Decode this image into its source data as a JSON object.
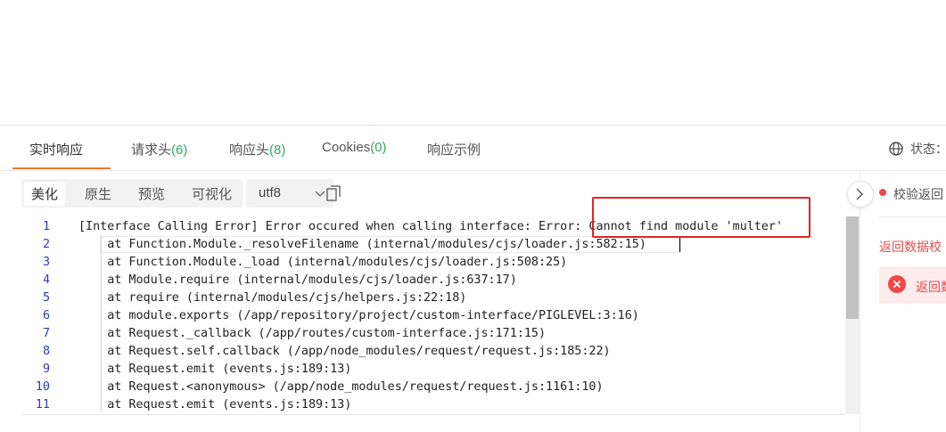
{
  "tabs": [
    {
      "label": "实时响应",
      "count": ""
    },
    {
      "label": "请求头",
      "count": "(6)"
    },
    {
      "label": "响应头",
      "count": "(8)"
    },
    {
      "label": "Cookies",
      "count": "(0)"
    },
    {
      "label": "响应示例",
      "count": ""
    }
  ],
  "status_label": "状态：",
  "toolbar": {
    "modes": [
      "美化",
      "原生",
      "预览",
      "可视化"
    ],
    "active_mode": "美化",
    "encoding": "utf8"
  },
  "right_panel": {
    "check_label": "校验返回",
    "validation_title": "返回数据校",
    "alert_text": "返回数"
  },
  "code_lines": [
    {
      "n": "1",
      "text": "[Interface Calling Error] Error occured when calling interface: Error: Cannot find module 'multer'"
    },
    {
      "n": "2",
      "text": "    at Function.Module._resolveFilename (internal/modules/cjs/loader.js:582:15)"
    },
    {
      "n": "3",
      "text": "    at Function.Module._load (internal/modules/cjs/loader.js:508:25)"
    },
    {
      "n": "4",
      "text": "    at Module.require (internal/modules/cjs/loader.js:637:17)"
    },
    {
      "n": "5",
      "text": "    at require (internal/modules/cjs/helpers.js:22:18)"
    },
    {
      "n": "6",
      "text": "    at module.exports (/app/repository/project/custom-interface/PIGLEVEL:3:16)"
    },
    {
      "n": "7",
      "text": "    at Request._callback (/app/routes/custom-interface.js:171:15)"
    },
    {
      "n": "8",
      "text": "    at Request.self.callback (/app/node_modules/request/request.js:185:22)"
    },
    {
      "n": "9",
      "text": "    at Request.emit (events.js:189:13)"
    },
    {
      "n": "10",
      "text": "    at Request.<anonymous> (/app/node_modules/request/request.js:1161:10)"
    },
    {
      "n": "11",
      "text": "    at Request.emit (events.js:189:13)"
    }
  ],
  "colors": {
    "accent": "#f0782d",
    "count_green": "#2fad62",
    "error_red": "#e32222",
    "line_number_blue": "#2b3bb8"
  }
}
